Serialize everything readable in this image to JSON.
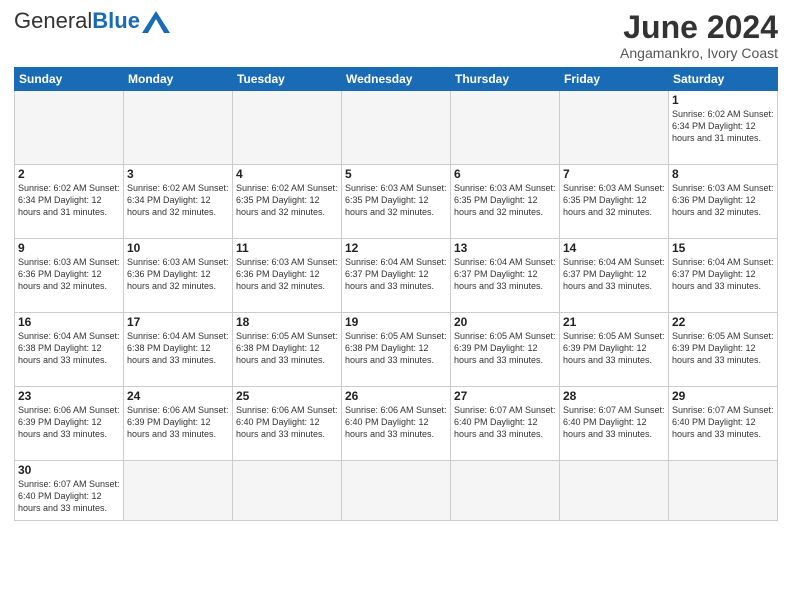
{
  "logo": {
    "text_general": "General",
    "text_blue": "Blue"
  },
  "title": "June 2024",
  "subtitle": "Angamankro, Ivory Coast",
  "days_of_week": [
    "Sunday",
    "Monday",
    "Tuesday",
    "Wednesday",
    "Thursday",
    "Friday",
    "Saturday"
  ],
  "weeks": [
    [
      {
        "day": "",
        "info": ""
      },
      {
        "day": "",
        "info": ""
      },
      {
        "day": "",
        "info": ""
      },
      {
        "day": "",
        "info": ""
      },
      {
        "day": "",
        "info": ""
      },
      {
        "day": "",
        "info": ""
      },
      {
        "day": "1",
        "info": "Sunrise: 6:02 AM\nSunset: 6:34 PM\nDaylight: 12 hours\nand 31 minutes."
      }
    ],
    [
      {
        "day": "2",
        "info": "Sunrise: 6:02 AM\nSunset: 6:34 PM\nDaylight: 12 hours\nand 31 minutes."
      },
      {
        "day": "3",
        "info": "Sunrise: 6:02 AM\nSunset: 6:34 PM\nDaylight: 12 hours\nand 32 minutes."
      },
      {
        "day": "4",
        "info": "Sunrise: 6:02 AM\nSunset: 6:35 PM\nDaylight: 12 hours\nand 32 minutes."
      },
      {
        "day": "5",
        "info": "Sunrise: 6:03 AM\nSunset: 6:35 PM\nDaylight: 12 hours\nand 32 minutes."
      },
      {
        "day": "6",
        "info": "Sunrise: 6:03 AM\nSunset: 6:35 PM\nDaylight: 12 hours\nand 32 minutes."
      },
      {
        "day": "7",
        "info": "Sunrise: 6:03 AM\nSunset: 6:35 PM\nDaylight: 12 hours\nand 32 minutes."
      },
      {
        "day": "8",
        "info": "Sunrise: 6:03 AM\nSunset: 6:36 PM\nDaylight: 12 hours\nand 32 minutes."
      }
    ],
    [
      {
        "day": "9",
        "info": "Sunrise: 6:03 AM\nSunset: 6:36 PM\nDaylight: 12 hours\nand 32 minutes."
      },
      {
        "day": "10",
        "info": "Sunrise: 6:03 AM\nSunset: 6:36 PM\nDaylight: 12 hours\nand 32 minutes."
      },
      {
        "day": "11",
        "info": "Sunrise: 6:03 AM\nSunset: 6:36 PM\nDaylight: 12 hours\nand 32 minutes."
      },
      {
        "day": "12",
        "info": "Sunrise: 6:04 AM\nSunset: 6:37 PM\nDaylight: 12 hours\nand 33 minutes."
      },
      {
        "day": "13",
        "info": "Sunrise: 6:04 AM\nSunset: 6:37 PM\nDaylight: 12 hours\nand 33 minutes."
      },
      {
        "day": "14",
        "info": "Sunrise: 6:04 AM\nSunset: 6:37 PM\nDaylight: 12 hours\nand 33 minutes."
      },
      {
        "day": "15",
        "info": "Sunrise: 6:04 AM\nSunset: 6:37 PM\nDaylight: 12 hours\nand 33 minutes."
      }
    ],
    [
      {
        "day": "16",
        "info": "Sunrise: 6:04 AM\nSunset: 6:38 PM\nDaylight: 12 hours\nand 33 minutes."
      },
      {
        "day": "17",
        "info": "Sunrise: 6:04 AM\nSunset: 6:38 PM\nDaylight: 12 hours\nand 33 minutes."
      },
      {
        "day": "18",
        "info": "Sunrise: 6:05 AM\nSunset: 6:38 PM\nDaylight: 12 hours\nand 33 minutes."
      },
      {
        "day": "19",
        "info": "Sunrise: 6:05 AM\nSunset: 6:38 PM\nDaylight: 12 hours\nand 33 minutes."
      },
      {
        "day": "20",
        "info": "Sunrise: 6:05 AM\nSunset: 6:39 PM\nDaylight: 12 hours\nand 33 minutes."
      },
      {
        "day": "21",
        "info": "Sunrise: 6:05 AM\nSunset: 6:39 PM\nDaylight: 12 hours\nand 33 minutes."
      },
      {
        "day": "22",
        "info": "Sunrise: 6:05 AM\nSunset: 6:39 PM\nDaylight: 12 hours\nand 33 minutes."
      }
    ],
    [
      {
        "day": "23",
        "info": "Sunrise: 6:06 AM\nSunset: 6:39 PM\nDaylight: 12 hours\nand 33 minutes."
      },
      {
        "day": "24",
        "info": "Sunrise: 6:06 AM\nSunset: 6:39 PM\nDaylight: 12 hours\nand 33 minutes."
      },
      {
        "day": "25",
        "info": "Sunrise: 6:06 AM\nSunset: 6:40 PM\nDaylight: 12 hours\nand 33 minutes."
      },
      {
        "day": "26",
        "info": "Sunrise: 6:06 AM\nSunset: 6:40 PM\nDaylight: 12 hours\nand 33 minutes."
      },
      {
        "day": "27",
        "info": "Sunrise: 6:07 AM\nSunset: 6:40 PM\nDaylight: 12 hours\nand 33 minutes."
      },
      {
        "day": "28",
        "info": "Sunrise: 6:07 AM\nSunset: 6:40 PM\nDaylight: 12 hours\nand 33 minutes."
      },
      {
        "day": "29",
        "info": "Sunrise: 6:07 AM\nSunset: 6:40 PM\nDaylight: 12 hours\nand 33 minutes."
      }
    ],
    [
      {
        "day": "30",
        "info": "Sunrise: 6:07 AM\nSunset: 6:40 PM\nDaylight: 12 hours\nand 33 minutes."
      },
      {
        "day": "",
        "info": ""
      },
      {
        "day": "",
        "info": ""
      },
      {
        "day": "",
        "info": ""
      },
      {
        "day": "",
        "info": ""
      },
      {
        "day": "",
        "info": ""
      },
      {
        "day": "",
        "info": ""
      }
    ]
  ]
}
